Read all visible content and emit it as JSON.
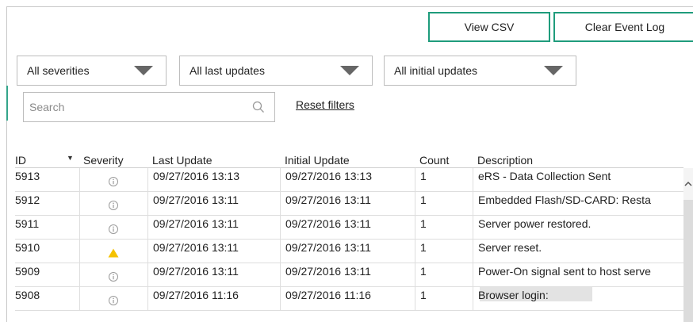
{
  "toolbar": {
    "view_csv_label": "View CSV",
    "clear_log_label": "Clear Event Log"
  },
  "filters": {
    "severity_value": "All severities",
    "last_update_value": "All last updates",
    "initial_update_value": "All initial updates"
  },
  "search": {
    "placeholder": "Search",
    "value": ""
  },
  "reset_filters_label": "Reset filters",
  "table": {
    "columns": {
      "id": "ID",
      "severity": "Severity",
      "last_update": "Last Update",
      "initial_update": "Initial Update",
      "count": "Count",
      "description": "Description"
    },
    "rows": [
      {
        "id": "5913",
        "severity": "info",
        "last_update": "09/27/2016 13:13",
        "initial_update": "09/27/2016 13:13",
        "count": "1",
        "description": "eRS - Data Collection Sent"
      },
      {
        "id": "5912",
        "severity": "info",
        "last_update": "09/27/2016 13:11",
        "initial_update": "09/27/2016 13:11",
        "count": "1",
        "description": "Embedded Flash/SD-CARD: Resta"
      },
      {
        "id": "5911",
        "severity": "info",
        "last_update": "09/27/2016 13:11",
        "initial_update": "09/27/2016 13:11",
        "count": "1",
        "description": "Server power restored."
      },
      {
        "id": "5910",
        "severity": "warning",
        "last_update": "09/27/2016 13:11",
        "initial_update": "09/27/2016 13:11",
        "count": "1",
        "description": "Server reset."
      },
      {
        "id": "5909",
        "severity": "info",
        "last_update": "09/27/2016 13:11",
        "initial_update": "09/27/2016 13:11",
        "count": "1",
        "description": "Power-On signal sent to host serve"
      },
      {
        "id": "5908",
        "severity": "info",
        "last_update": "09/27/2016 11:16",
        "initial_update": "09/27/2016 11:16",
        "count": "1",
        "description": "Browser login:"
      }
    ]
  },
  "colors": {
    "accent": "#1f9c7c",
    "warning": "#f5c200",
    "info_icon": "#9a9a9a"
  }
}
